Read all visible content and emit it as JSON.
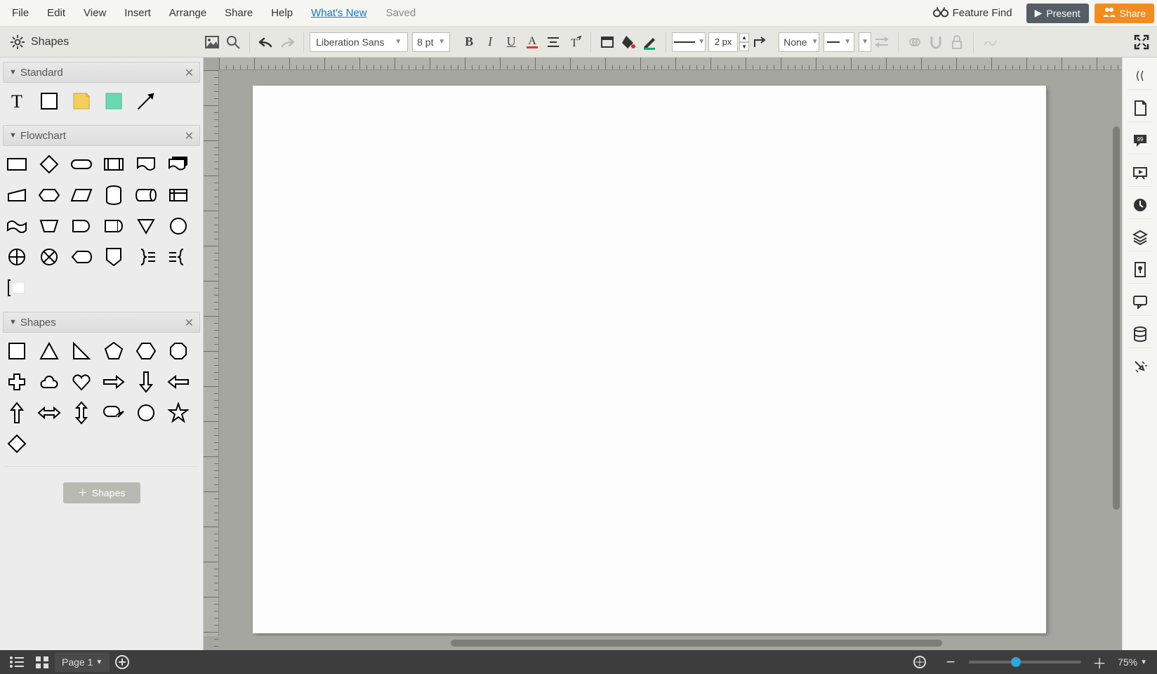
{
  "menu": {
    "items": [
      "File",
      "Edit",
      "View",
      "Insert",
      "Arrange",
      "Share",
      "Help"
    ],
    "whats_new": "What's New",
    "saved": "Saved"
  },
  "header": {
    "feature_find": "Feature Find",
    "present": "Present",
    "share": "Share"
  },
  "toolbar": {
    "font": "Liberation Sans",
    "font_size": "8 pt",
    "line_width": "2 px",
    "arrow_start": "None"
  },
  "shapes_panel": {
    "header": "Shapes",
    "sections": {
      "standard": "Standard",
      "flowchart": "Flowchart",
      "shapes": "Shapes"
    },
    "add_shapes": "Shapes"
  },
  "bottom": {
    "page_label": "Page 1",
    "zoom": "75%"
  }
}
